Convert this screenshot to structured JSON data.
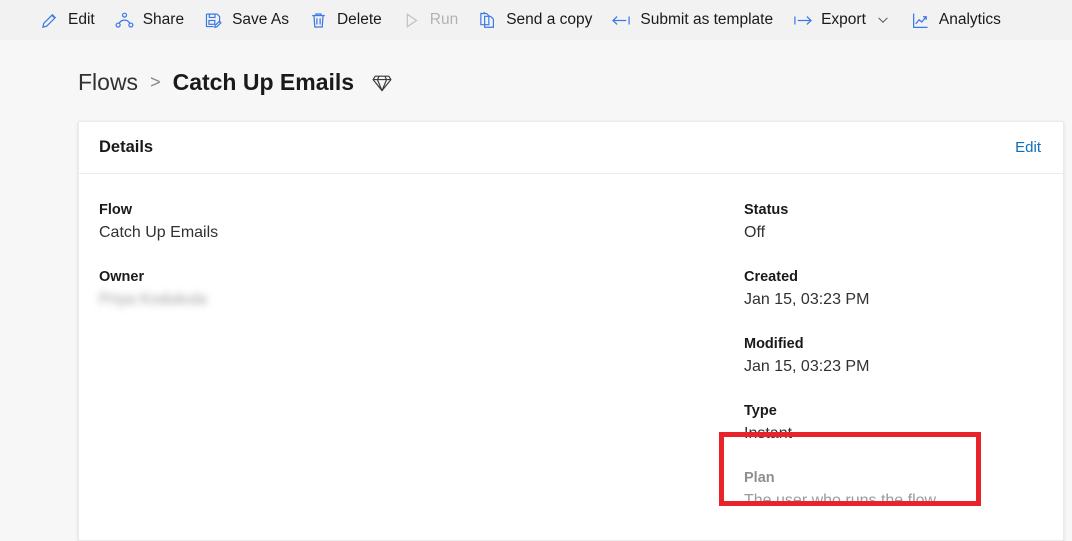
{
  "theme": {
    "accent": "#0f6cbd",
    "icon_blue": "#2b7cd3",
    "text": "#1b1a19",
    "muted": "#9a9a9a",
    "disabled": "#b4b2b0",
    "annotation_red": "#e8232a",
    "page_bg": "#f7f7f7",
    "commandbar_bg": "#f2f2f2"
  },
  "commandbar": {
    "items": [
      {
        "label": "Edit",
        "icon": "pencil-icon",
        "disabled": false
      },
      {
        "label": "Share",
        "icon": "share-icon",
        "disabled": false
      },
      {
        "label": "Save As",
        "icon": "save-as-icon",
        "disabled": false
      },
      {
        "label": "Delete",
        "icon": "trash-icon",
        "disabled": false
      },
      {
        "label": "Run",
        "icon": "play-icon",
        "disabled": true
      },
      {
        "label": "Send a copy",
        "icon": "copy-icon",
        "disabled": false
      },
      {
        "label": "Submit as template",
        "icon": "arrow-left-bar-icon",
        "disabled": false
      },
      {
        "label": "Export",
        "icon": "arrow-right-bar-icon",
        "disabled": false,
        "chevron": "chevron-down-icon"
      },
      {
        "label": "Analytics",
        "icon": "analytics-chart-icon",
        "disabled": false
      }
    ]
  },
  "breadcrumb": {
    "root": "Flows",
    "separator": ">",
    "current": "Catch Up Emails",
    "badge_icon": "premium-diamond-icon"
  },
  "details_card": {
    "title": "Details",
    "edit_link": "Edit",
    "left_fields": [
      {
        "label": "Flow",
        "value": "Catch Up Emails",
        "blurred": false
      },
      {
        "label": "Owner",
        "value": "Priya Kodukula",
        "blurred": true
      }
    ],
    "right_fields": [
      {
        "label": "Status",
        "value": "Off"
      },
      {
        "label": "Created",
        "value": "Jan 15, 03:23 PM"
      },
      {
        "label": "Modified",
        "value": "Jan 15, 03:23 PM"
      },
      {
        "label": "Type",
        "value": "Instant"
      }
    ],
    "plan_field": {
      "label": "Plan",
      "value": "The user who runs the flow"
    }
  }
}
